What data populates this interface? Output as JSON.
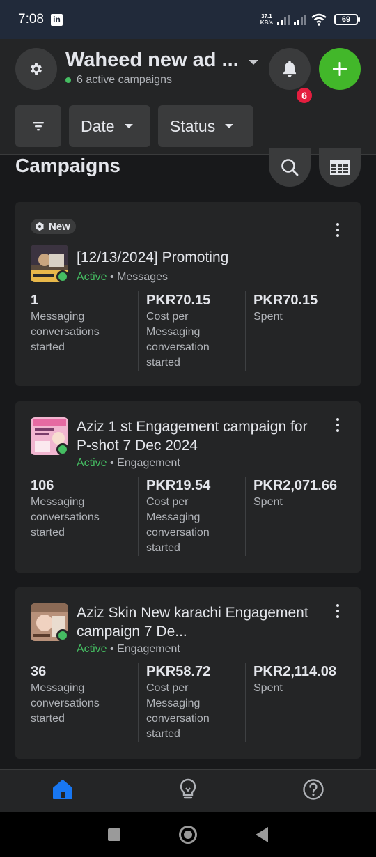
{
  "status_bar": {
    "time": "7:08",
    "app_badge": "in",
    "speed_top": "37.1",
    "speed_bottom": "KB/s",
    "battery": "69"
  },
  "header": {
    "account_name": "Waheed new ad ...",
    "active_campaigns": "6 active campaigns",
    "notification_count": "6",
    "icons": {
      "settings": "gear-icon",
      "notifications": "bell-icon",
      "create": "plus-icon"
    }
  },
  "filters": {
    "filter_icon": "filter-icon",
    "date_label": "Date",
    "status_label": "Status"
  },
  "section": {
    "title": "Campaigns",
    "search_icon": "search-icon",
    "table_icon": "table-icon"
  },
  "campaigns": [
    {
      "badge": "New",
      "name": "[12/13/2024] Promoting",
      "status": "Active",
      "objective": "Messages",
      "metrics": [
        {
          "value": "1",
          "label": "Messaging conversations started"
        },
        {
          "value": "PKR70.15",
          "label": "Cost per Messaging conversation started"
        },
        {
          "value": "PKR70.15",
          "label": "Spent"
        }
      ]
    },
    {
      "name": "Aziz 1 st Engagement campaign for P-shot 7 Dec 2024",
      "status": "Active",
      "objective": "Engagement",
      "metrics": [
        {
          "value": "106",
          "label": "Messaging conversations started"
        },
        {
          "value": "PKR19.54",
          "label": "Cost per Messaging conversation started"
        },
        {
          "value": "PKR2,071.66",
          "label": "Spent"
        }
      ]
    },
    {
      "name": "Aziz Skin New karachi Engagement campaign 7 De...",
      "status": "Active",
      "objective": "Engagement",
      "metrics": [
        {
          "value": "36",
          "label": "Messaging conversations started"
        },
        {
          "value": "PKR58.72",
          "label": "Cost per Messaging conversation started"
        },
        {
          "value": "PKR2,114.08",
          "label": "Spent"
        }
      ]
    }
  ],
  "bottom_nav": [
    "home-icon",
    "lightbulb-icon",
    "help-icon"
  ],
  "colors": {
    "active": "#45bd62",
    "create": "#42b72a",
    "home_accent": "#1877f2",
    "badge": "#e41e3f"
  }
}
